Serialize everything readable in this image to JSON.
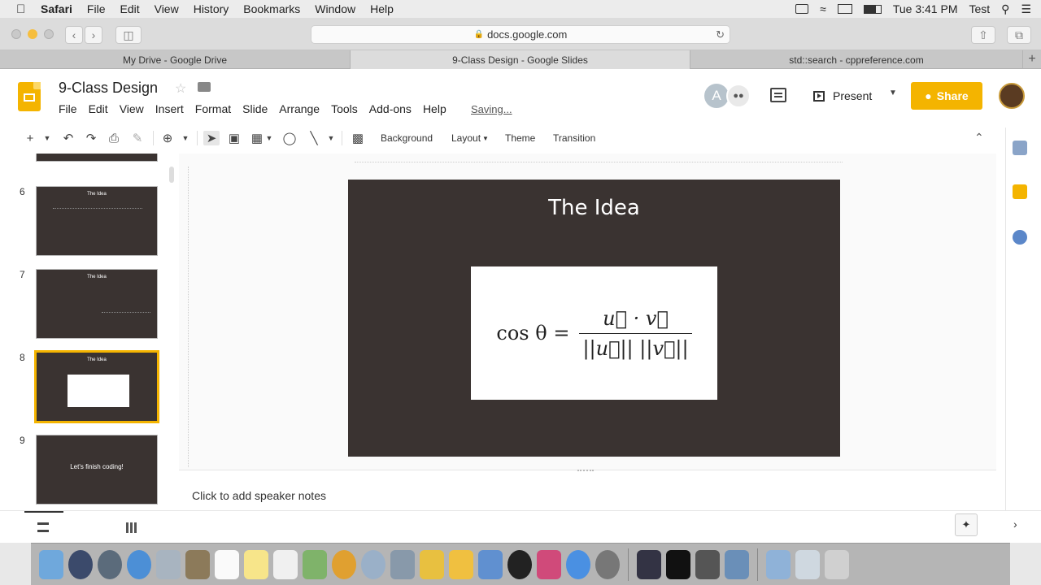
{
  "menubar": {
    "app": "Safari",
    "items": [
      "File",
      "Edit",
      "View",
      "History",
      "Bookmarks",
      "Window",
      "Help"
    ],
    "clock": "Tue 3:41 PM",
    "user": "Test"
  },
  "safari": {
    "url": "docs.google.com",
    "tabs": [
      {
        "label": "My Drive - Google Drive",
        "active": false
      },
      {
        "label": "9-Class Design - Google Slides",
        "active": true
      },
      {
        "label": "std::search - cppreference.com",
        "active": false
      }
    ]
  },
  "slides": {
    "doc_title": "9-Class Design",
    "menu": [
      "File",
      "Edit",
      "View",
      "Insert",
      "Format",
      "Slide",
      "Arrange",
      "Tools",
      "Add-ons",
      "Help"
    ],
    "saving_status": "Saving...",
    "avatar_letter": "A",
    "present_label": "Present",
    "share_label": "Share",
    "toolbar": {
      "background": "Background",
      "layout": "Layout",
      "theme": "Theme",
      "transition": "Transition"
    },
    "filmstrip": [
      {
        "num": "6",
        "title": "The Idea"
      },
      {
        "num": "7",
        "title": "The Idea"
      },
      {
        "num": "8",
        "title": "The Idea",
        "selected": true
      },
      {
        "num": "9",
        "text": "Let's finish coding!"
      }
    ],
    "current_slide": {
      "title": "The Idea",
      "formula": {
        "lhs": "cos θ =",
        "numerator": "u⃗ · v⃗",
        "denominator": "||u⃗|| ||v⃗||"
      }
    },
    "speaker_notes": "Click to add speaker notes"
  },
  "colors": {
    "accent": "#f4b400",
    "slide_bg": "#3a3331"
  }
}
